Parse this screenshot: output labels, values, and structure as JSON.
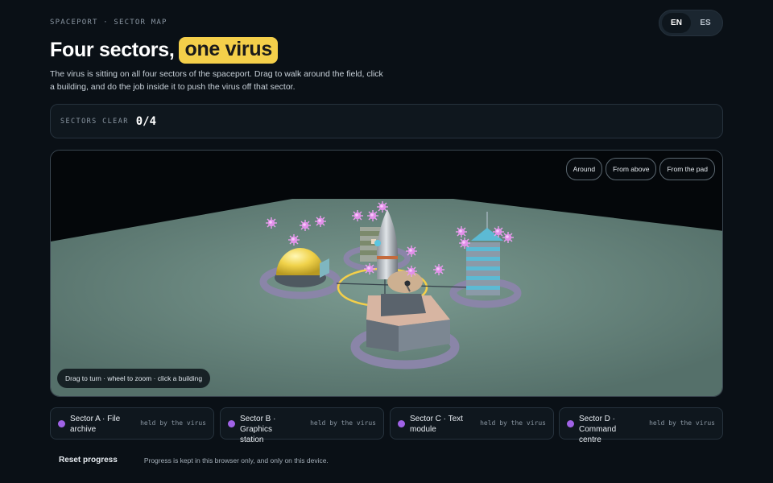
{
  "header": {
    "eyebrow": "SPACEPORT · SECTOR MAP",
    "title_main": "Four sectors,",
    "title_highlight": "one virus",
    "intro": "The virus is sitting on all four sectors of the spaceport. Drag to walk around the field, click a building, and do the job inside it to push the virus off that sector."
  },
  "language": {
    "options": [
      "EN",
      "ES"
    ],
    "selected": "EN"
  },
  "progress": {
    "label": "SECTORS CLEAR",
    "value": "0/4"
  },
  "scene": {
    "view_buttons": [
      "Around",
      "From above",
      "From the pad"
    ],
    "hint": "Drag to turn · wheel to zoom · click a building",
    "colors": {
      "ground": "#5e7a72",
      "ring": "#8a85a8",
      "virus": "#e290e9",
      "dome": "#f0d24a",
      "highlight": "#f4cf4a"
    }
  },
  "sectors": [
    {
      "name": "Sector A · File archive",
      "status": "held by the virus",
      "color": "#a062e6"
    },
    {
      "name": "Sector B · Graphics station",
      "status": "held by the virus",
      "color": "#a062e6"
    },
    {
      "name": "Sector C · Text module",
      "status": "held by the virus",
      "color": "#a062e6"
    },
    {
      "name": "Sector D · Command centre",
      "status": "held by the virus",
      "color": "#a062e6"
    }
  ],
  "footer": {
    "reset_label": "Reset progress",
    "note": "Progress is kept in this browser only, and only on this device."
  }
}
